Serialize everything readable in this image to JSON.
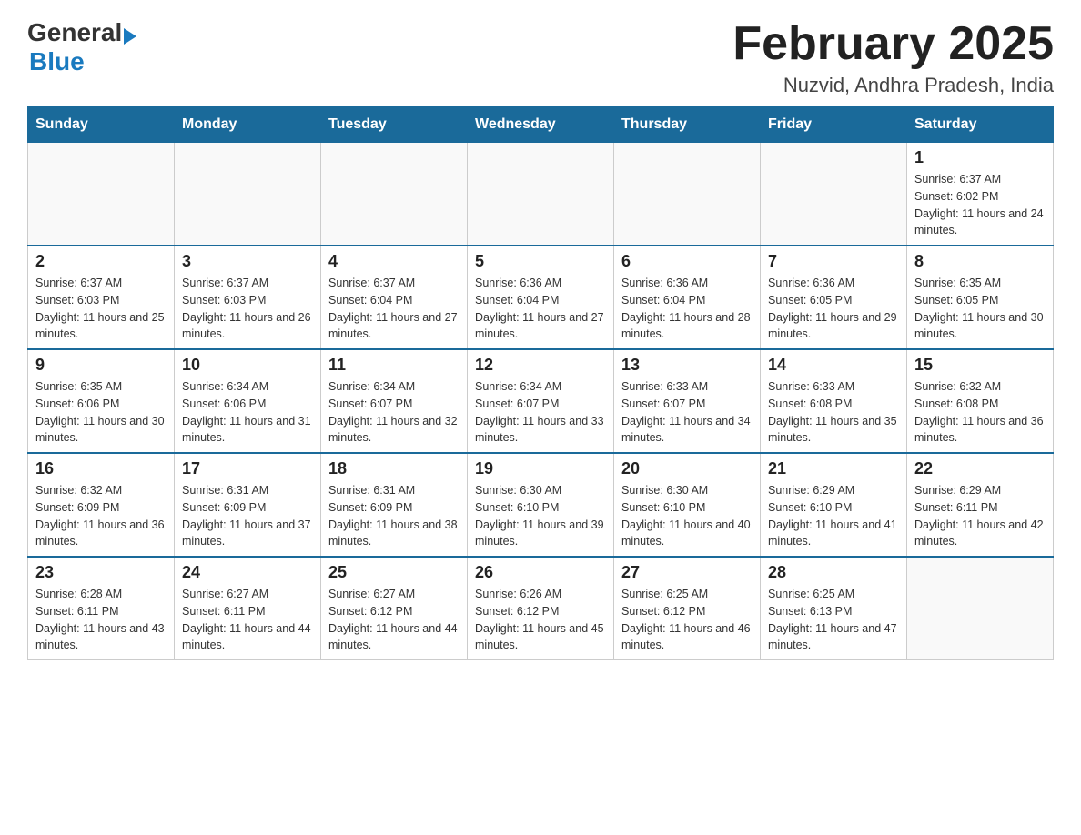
{
  "header": {
    "logo_general": "General",
    "logo_blue": "Blue",
    "month_title": "February 2025",
    "location": "Nuzvid, Andhra Pradesh, India"
  },
  "days_of_week": [
    "Sunday",
    "Monday",
    "Tuesday",
    "Wednesday",
    "Thursday",
    "Friday",
    "Saturday"
  ],
  "weeks": [
    [
      {
        "day": "",
        "info": ""
      },
      {
        "day": "",
        "info": ""
      },
      {
        "day": "",
        "info": ""
      },
      {
        "day": "",
        "info": ""
      },
      {
        "day": "",
        "info": ""
      },
      {
        "day": "",
        "info": ""
      },
      {
        "day": "1",
        "info": "Sunrise: 6:37 AM\nSunset: 6:02 PM\nDaylight: 11 hours and 24 minutes."
      }
    ],
    [
      {
        "day": "2",
        "info": "Sunrise: 6:37 AM\nSunset: 6:03 PM\nDaylight: 11 hours and 25 minutes."
      },
      {
        "day": "3",
        "info": "Sunrise: 6:37 AM\nSunset: 6:03 PM\nDaylight: 11 hours and 26 minutes."
      },
      {
        "day": "4",
        "info": "Sunrise: 6:37 AM\nSunset: 6:04 PM\nDaylight: 11 hours and 27 minutes."
      },
      {
        "day": "5",
        "info": "Sunrise: 6:36 AM\nSunset: 6:04 PM\nDaylight: 11 hours and 27 minutes."
      },
      {
        "day": "6",
        "info": "Sunrise: 6:36 AM\nSunset: 6:04 PM\nDaylight: 11 hours and 28 minutes."
      },
      {
        "day": "7",
        "info": "Sunrise: 6:36 AM\nSunset: 6:05 PM\nDaylight: 11 hours and 29 minutes."
      },
      {
        "day": "8",
        "info": "Sunrise: 6:35 AM\nSunset: 6:05 PM\nDaylight: 11 hours and 30 minutes."
      }
    ],
    [
      {
        "day": "9",
        "info": "Sunrise: 6:35 AM\nSunset: 6:06 PM\nDaylight: 11 hours and 30 minutes."
      },
      {
        "day": "10",
        "info": "Sunrise: 6:34 AM\nSunset: 6:06 PM\nDaylight: 11 hours and 31 minutes."
      },
      {
        "day": "11",
        "info": "Sunrise: 6:34 AM\nSunset: 6:07 PM\nDaylight: 11 hours and 32 minutes."
      },
      {
        "day": "12",
        "info": "Sunrise: 6:34 AM\nSunset: 6:07 PM\nDaylight: 11 hours and 33 minutes."
      },
      {
        "day": "13",
        "info": "Sunrise: 6:33 AM\nSunset: 6:07 PM\nDaylight: 11 hours and 34 minutes."
      },
      {
        "day": "14",
        "info": "Sunrise: 6:33 AM\nSunset: 6:08 PM\nDaylight: 11 hours and 35 minutes."
      },
      {
        "day": "15",
        "info": "Sunrise: 6:32 AM\nSunset: 6:08 PM\nDaylight: 11 hours and 36 minutes."
      }
    ],
    [
      {
        "day": "16",
        "info": "Sunrise: 6:32 AM\nSunset: 6:09 PM\nDaylight: 11 hours and 36 minutes."
      },
      {
        "day": "17",
        "info": "Sunrise: 6:31 AM\nSunset: 6:09 PM\nDaylight: 11 hours and 37 minutes."
      },
      {
        "day": "18",
        "info": "Sunrise: 6:31 AM\nSunset: 6:09 PM\nDaylight: 11 hours and 38 minutes."
      },
      {
        "day": "19",
        "info": "Sunrise: 6:30 AM\nSunset: 6:10 PM\nDaylight: 11 hours and 39 minutes."
      },
      {
        "day": "20",
        "info": "Sunrise: 6:30 AM\nSunset: 6:10 PM\nDaylight: 11 hours and 40 minutes."
      },
      {
        "day": "21",
        "info": "Sunrise: 6:29 AM\nSunset: 6:10 PM\nDaylight: 11 hours and 41 minutes."
      },
      {
        "day": "22",
        "info": "Sunrise: 6:29 AM\nSunset: 6:11 PM\nDaylight: 11 hours and 42 minutes."
      }
    ],
    [
      {
        "day": "23",
        "info": "Sunrise: 6:28 AM\nSunset: 6:11 PM\nDaylight: 11 hours and 43 minutes."
      },
      {
        "day": "24",
        "info": "Sunrise: 6:27 AM\nSunset: 6:11 PM\nDaylight: 11 hours and 44 minutes."
      },
      {
        "day": "25",
        "info": "Sunrise: 6:27 AM\nSunset: 6:12 PM\nDaylight: 11 hours and 44 minutes."
      },
      {
        "day": "26",
        "info": "Sunrise: 6:26 AM\nSunset: 6:12 PM\nDaylight: 11 hours and 45 minutes."
      },
      {
        "day": "27",
        "info": "Sunrise: 6:25 AM\nSunset: 6:12 PM\nDaylight: 11 hours and 46 minutes."
      },
      {
        "day": "28",
        "info": "Sunrise: 6:25 AM\nSunset: 6:13 PM\nDaylight: 11 hours and 47 minutes."
      },
      {
        "day": "",
        "info": ""
      }
    ]
  ]
}
